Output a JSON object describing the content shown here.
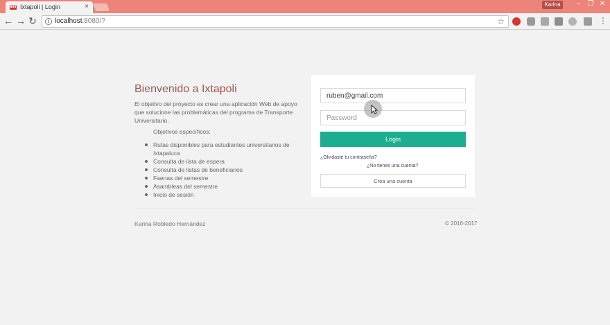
{
  "browser": {
    "tab_title": "Ixtapoli | Login",
    "tab_close": "×",
    "profile_name": "Karina",
    "url_host": "localhost",
    "url_rest": ":8080/?",
    "minimize_glyph": "–",
    "restore_glyph": "❐",
    "close_glyph": "✕",
    "menu_glyph": "⋮",
    "back_glyph": "←",
    "forward_glyph": "→",
    "reload_glyph": "↻",
    "star_glyph": "☆",
    "info_glyph": "i",
    "titlebar_color": "#ec8479"
  },
  "page": {
    "title": "Bienvenido a Ixtapoli",
    "intro": "El objetivo del proyecto es crear una aplicación Web de apoyo que solucione las problemáticas del programa de Transporte Universitario.",
    "objectives_title": "Objetivos específicos:",
    "objectives": [
      "Rutas disponibles para estudiantes universitarios de Ixtapaluca",
      "Consulta de lista de espera",
      "Consulta de listas de beneficiarios",
      "Faenas del semestre",
      "Asambleas del semestre",
      "Inicio de sesión"
    ]
  },
  "login": {
    "email_value": "ruben@gmail.com",
    "password_placeholder": "Password",
    "login_button": "Login",
    "forgot_password": "¿Olvidaste tu contraseña?",
    "no_account": "¿No tienes una cuenta?",
    "create_account": "Crea una cuenta",
    "accent_color": "#1cae8e"
  },
  "footer": {
    "author": "Karina Robledo Hernández",
    "copyright": "© 2016-2017"
  }
}
